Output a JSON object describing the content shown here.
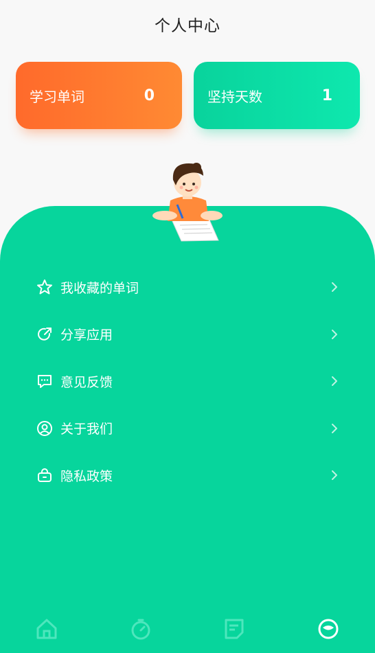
{
  "header": {
    "title": "个人中心"
  },
  "stats": [
    {
      "label": "学习单词",
      "value": "0"
    },
    {
      "label": "坚持天数",
      "value": "1"
    }
  ],
  "menu": [
    {
      "label": "我收藏的单词",
      "icon": "star-icon"
    },
    {
      "label": "分享应用",
      "icon": "share-icon"
    },
    {
      "label": "意见反馈",
      "icon": "feedback-icon"
    },
    {
      "label": "关于我们",
      "icon": "user-circle-icon"
    },
    {
      "label": "隐私政策",
      "icon": "lock-icon"
    }
  ],
  "tabbar": [
    {
      "name": "home",
      "icon": "home-icon",
      "active": false
    },
    {
      "name": "timer",
      "icon": "stopwatch-icon",
      "active": false
    },
    {
      "name": "notes",
      "icon": "note-icon",
      "active": false
    },
    {
      "name": "profile",
      "icon": "face-icon",
      "active": true
    }
  ],
  "colors": {
    "accent_green": "#07d59c",
    "orange": "#ff6a2b",
    "tab_inactive": "#4ee6bd",
    "tab_active": "#ffffff"
  }
}
